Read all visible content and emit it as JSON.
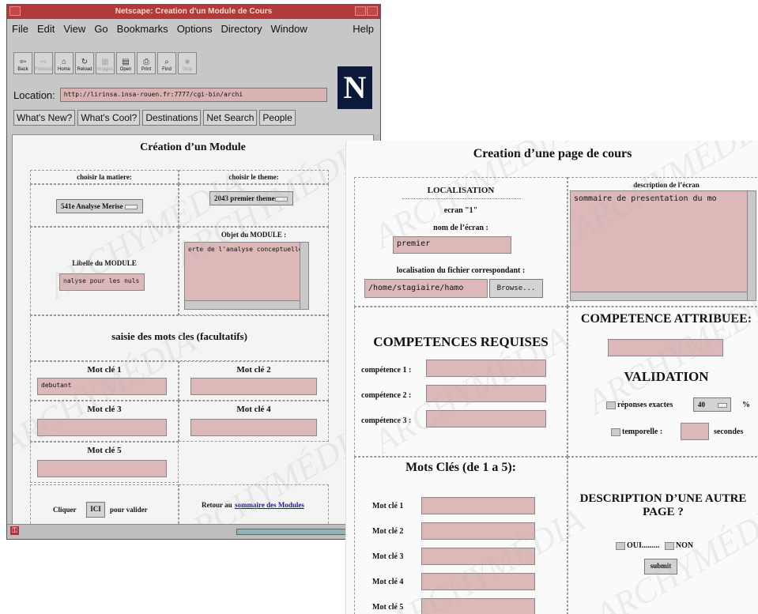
{
  "window": {
    "title": "Netscape: Creation d'un Module de Cours",
    "menu": [
      "File",
      "Edit",
      "View",
      "Go",
      "Bookmarks",
      "Options",
      "Directory",
      "Window",
      "Help"
    ],
    "toolbar": [
      {
        "label": "Back",
        "icon": "back-arrow-icon",
        "glyph": "⇦",
        "enabled": true
      },
      {
        "label": "Forward",
        "icon": "forward-arrow-icon",
        "glyph": "⇨",
        "enabled": false
      },
      {
        "label": "Home",
        "icon": "home-icon",
        "glyph": "⌂",
        "enabled": true
      },
      {
        "label": "Reload",
        "icon": "reload-icon",
        "glyph": "↻",
        "enabled": true
      },
      {
        "label": "Images",
        "icon": "images-icon",
        "glyph": "▦",
        "enabled": false
      },
      {
        "label": "Open",
        "icon": "open-icon",
        "glyph": "▤",
        "enabled": true
      },
      {
        "label": "Print",
        "icon": "print-icon",
        "glyph": "⎙",
        "enabled": true
      },
      {
        "label": "Find",
        "icon": "find-icon",
        "glyph": "⌕",
        "enabled": true
      },
      {
        "label": "Stop",
        "icon": "stop-icon",
        "glyph": "■",
        "enabled": false
      }
    ],
    "location_label": "Location:",
    "location_value": "http://lirinsa.insa-rouen.fr:7777/cgi-bin/archi",
    "directory_buttons": [
      "What's New?",
      "What's Cool?",
      "Destinations",
      "Net Search",
      "People"
    ],
    "logo": "N"
  },
  "module": {
    "title": "Création d’un Module",
    "matiere_label": "choisir la matiere:",
    "matiere_value": "541e Analyse Merise",
    "theme_label": "choisir le theme:",
    "theme_value": "2043 premier theme",
    "libelle_label": "Libelle du MODULE",
    "libelle_value": "nalyse pour les nuls",
    "objet_label": "Objet du MODULE :",
    "objet_value": "erte de l'analyse conceptuelle",
    "keywords_title": "saisie des mots cles (facultatifs)",
    "keywords": [
      {
        "label": "Mot clé 1",
        "value": "debutant"
      },
      {
        "label": "Mot clé 2",
        "value": ""
      },
      {
        "label": "Mot clé 3",
        "value": ""
      },
      {
        "label": "Mot clé 4",
        "value": ""
      },
      {
        "label": "Mot clé 5",
        "value": ""
      }
    ],
    "click_prefix": "Cliquer",
    "click_button": "ICI",
    "click_suffix": "pour valider",
    "retour_prefix": "Retour au",
    "retour_link": "sommaire des Modules"
  },
  "page2": {
    "title": "Creation d’une page de cours",
    "localisation_title": "LOCALISATION",
    "ecran_label": "ecran \"1\"",
    "nom_label": "nom de l’écran :",
    "nom_value": "premier",
    "fichier_label": "localisation du fichier correspondant :",
    "fichier_value": "/home/stagiaire/hamo",
    "browse_label": "Browse...",
    "description_label": "description de l’écran",
    "description_value": "sommaire de presentation du mo",
    "competence_attribuee_title": "COMPETENCE ATTRIBUEE:",
    "competences_requises_title": "COMPETENCES REQUISES",
    "competences": [
      "compétence 1 :",
      "compétence 2 :",
      "compétence 3 :"
    ],
    "validation_title": "VALIDATION",
    "reponses_label": "réponses exactes",
    "reponses_value": "40",
    "percent": "%",
    "temporelle_label": "temporelle :",
    "secondes": "secondes",
    "motscles_title": "Mots Clés (de 1 a 5):",
    "motscles": [
      "Mot clé 1",
      "Mot clé 2",
      "Mot clé 3",
      "Mot clé 4",
      "Mot clé 5"
    ],
    "autre_page_title": "DESCRIPTION D’UNE AUTRE PAGE ?",
    "oui_label": "OUI.........",
    "non_label": "NON",
    "submit_label": "submit"
  },
  "watermark": "ARCHYMÉDIA"
}
